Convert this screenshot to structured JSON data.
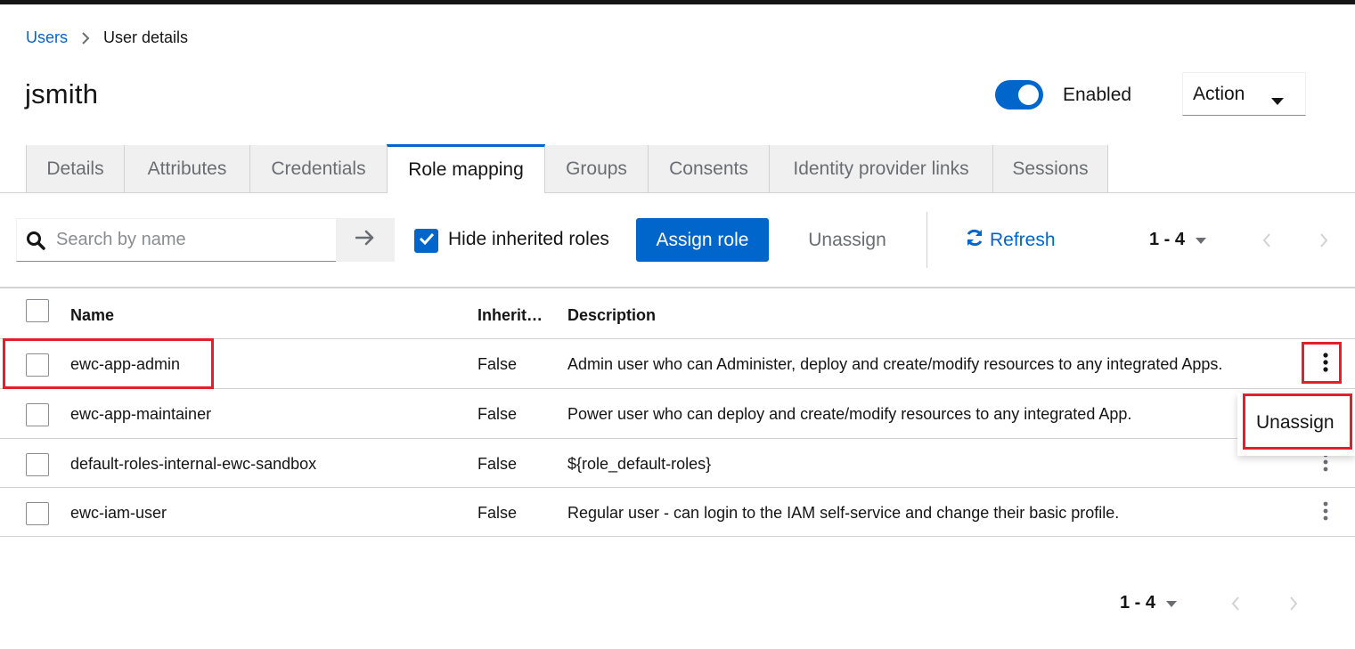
{
  "breadcrumb": {
    "parent": "Users",
    "current": "User details"
  },
  "page": {
    "title": "jsmith"
  },
  "header": {
    "enabled_label": "Enabled",
    "enabled": true,
    "action_label": "Action"
  },
  "tabs": [
    {
      "label": "Details"
    },
    {
      "label": "Attributes"
    },
    {
      "label": "Credentials"
    },
    {
      "label": "Role mapping",
      "active": true
    },
    {
      "label": "Groups"
    },
    {
      "label": "Consents"
    },
    {
      "label": "Identity provider links"
    },
    {
      "label": "Sessions"
    }
  ],
  "toolbar": {
    "search_placeholder": "Search by name",
    "hide_inherited_label": "Hide inherited roles",
    "hide_inherited_checked": true,
    "assign_label": "Assign role",
    "unassign_label": "Unassign",
    "refresh_label": "Refresh",
    "pagination": "1 - 4"
  },
  "table": {
    "columns": {
      "name": "Name",
      "inherited": "Inherit…",
      "description": "Description"
    },
    "rows": [
      {
        "name": "ewc-app-admin",
        "inherited": "False",
        "description": "Admin user who can Administer, deploy and create/modify resources to any integrated Apps."
      },
      {
        "name": "ewc-app-maintainer",
        "inherited": "False",
        "description": "Power user who can deploy and create/modify resources to any integrated App."
      },
      {
        "name": "default-roles-internal-ewc-sandbox",
        "inherited": "False",
        "description": "${role_default-roles}"
      },
      {
        "name": "ewc-iam-user",
        "inherited": "False",
        "description": "Regular user - can login to the IAM self-service and change their basic profile."
      }
    ]
  },
  "row_menu": {
    "unassign_label": "Unassign"
  },
  "footer": {
    "pagination": "1 - 4"
  },
  "colors": {
    "accent": "#0066cc",
    "highlight": "#e2202c"
  }
}
